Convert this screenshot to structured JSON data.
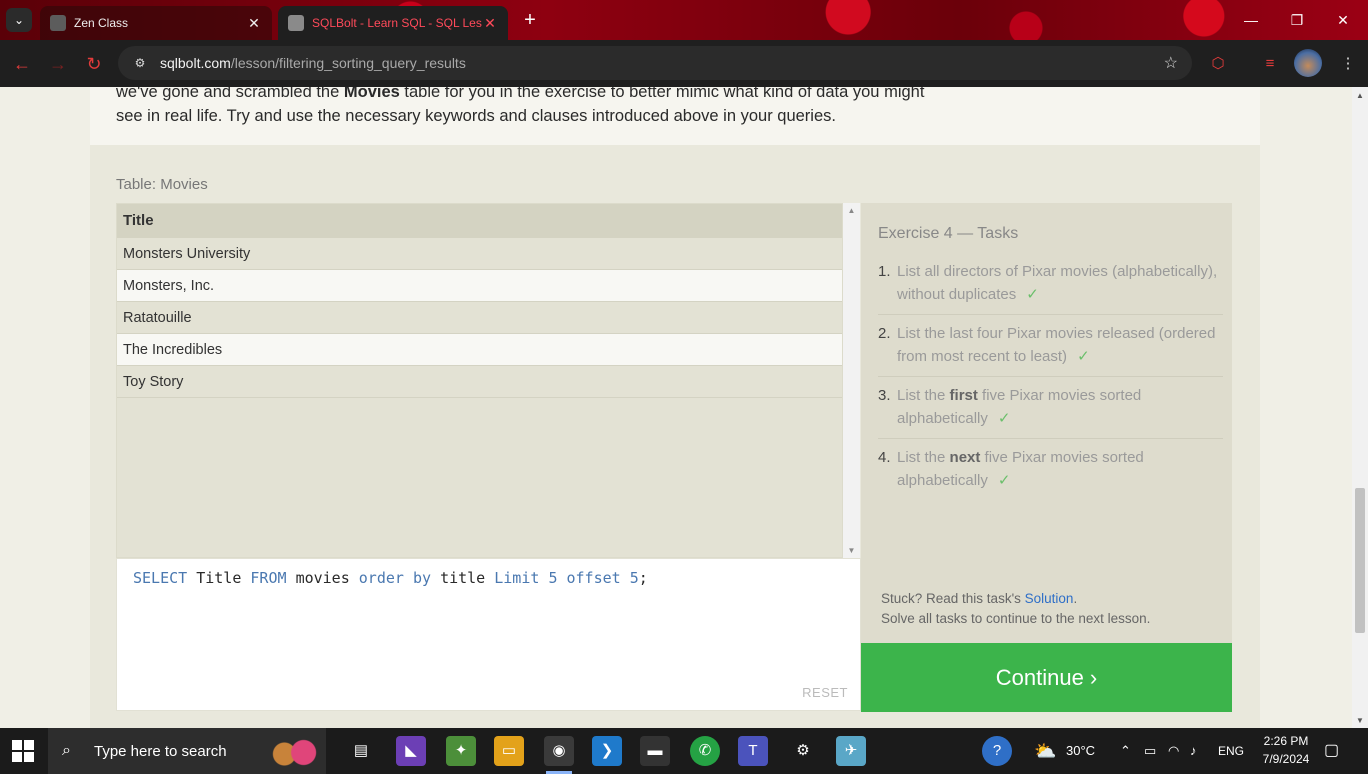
{
  "browser": {
    "tabs": [
      {
        "label": "Zen Class",
        "close": "✕"
      },
      {
        "label": "SQLBolt - Learn SQL - SQL Less",
        "close": "✕"
      }
    ],
    "new_tab": "+",
    "url_host": "sqlbolt.com",
    "url_path": "/lesson/filtering_sorting_query_results"
  },
  "intro": {
    "line1_pre": "we've gone and scrambled the ",
    "line1_bold": "Movies",
    "line1_post": " table for you in the exercise to better mimic what kind of data you",
    "line2": "might see in real life. Try and use the necessary keywords and clauses introduced above in your queries."
  },
  "table": {
    "caption": "Table: Movies",
    "header": "Title",
    "rows": [
      "Monsters University",
      "Monsters, Inc.",
      "Ratatouille",
      "The Incredibles",
      "Toy Story"
    ]
  },
  "editor": {
    "tokens": [
      "SELECT",
      "Title",
      "FROM",
      "movies",
      "order by",
      "title",
      "Limit",
      "5",
      "offset",
      "5",
      ";"
    ],
    "reset": "RESET"
  },
  "tasks": {
    "title": "Exercise 4 — Tasks",
    "items": [
      {
        "num": "1.",
        "pre": "List all directors of Pixar movies (alphabetically), without duplicates",
        "bold": "",
        "post": "",
        "check": "✓"
      },
      {
        "num": "2.",
        "pre": "List the last four Pixar movies released (ordered from most recent to least)",
        "bold": "",
        "post": "",
        "check": "✓"
      },
      {
        "num": "3.",
        "pre": "List the ",
        "bold": "first",
        "post": " five Pixar movies sorted alphabetically",
        "check": "✓"
      },
      {
        "num": "4.",
        "pre": "List the ",
        "bold": "next",
        "post": " five Pixar movies sorted alphabetically",
        "check": "✓"
      }
    ],
    "stuck_pre": "Stuck? Read this task's ",
    "stuck_link": "Solution",
    "stuck_post": ".",
    "solve_all": "Solve all tasks to continue to the next lesson."
  },
  "continue_label": "Continue ›",
  "taskbar": {
    "search_placeholder": "Type here to search",
    "weather": "30°C",
    "lang": "ENG",
    "time": "2:26 PM",
    "date": "7/9/2024"
  },
  "colors": {
    "accent_green": "#3cb44b",
    "link_blue": "#2f6fc7",
    "keyword_blue": "#4a78b0",
    "check_green": "#6bbf6b"
  }
}
